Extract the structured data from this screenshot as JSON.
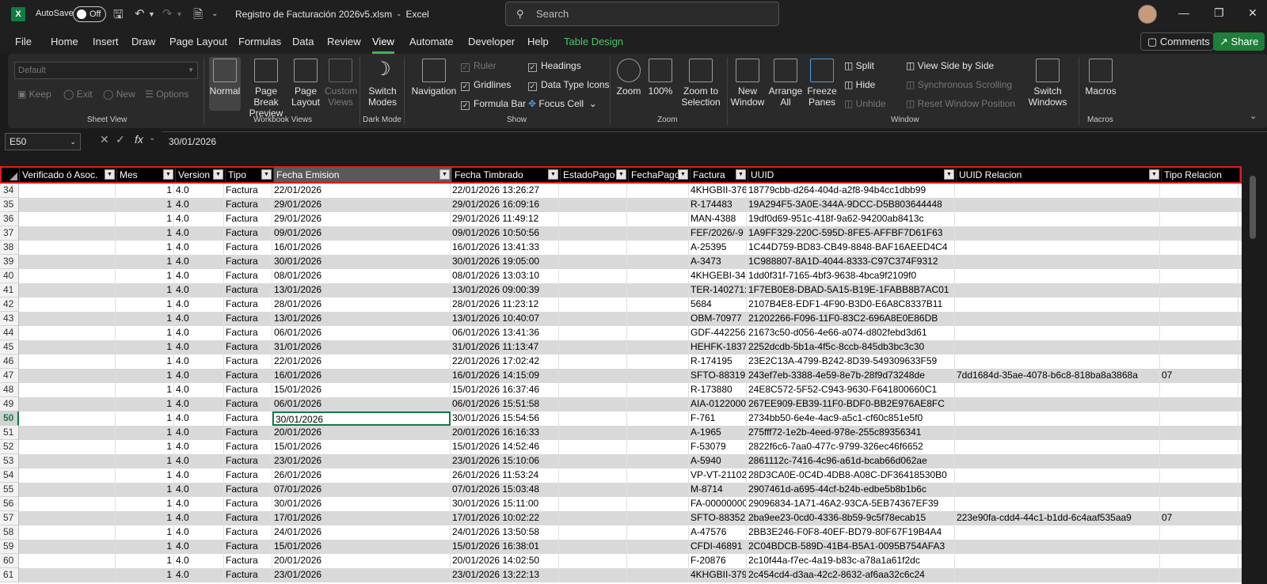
{
  "titlebar": {
    "autosave_label": "AutoSave",
    "autosave_state": "Off",
    "filename": "Registro de Facturación 2026v5.xlsm",
    "app": "Excel",
    "search_placeholder": "Search"
  },
  "menu": {
    "items": [
      "File",
      "Home",
      "Insert",
      "Draw",
      "Page Layout",
      "Formulas",
      "Data",
      "Review",
      "View",
      "Automate",
      "Developer",
      "Help",
      "Table Design"
    ],
    "active": "View",
    "comments": "Comments",
    "share": "Share"
  },
  "ribbon": {
    "sheet_view": {
      "dropdown": "Default",
      "keep": "Keep",
      "exit": "Exit",
      "new": "New",
      "options": "Options",
      "label": "Sheet View"
    },
    "workbook_views": {
      "normal": "Normal",
      "page_break": "Page Break Preview",
      "page_layout": "Page Layout",
      "custom_views": "Custom Views",
      "label": "Workbook Views"
    },
    "dark_mode": {
      "switch": "Switch Modes",
      "label": "Dark Mode"
    },
    "show": {
      "navigation": "Navigation",
      "ruler": "Ruler",
      "gridlines": "Gridlines",
      "formula_bar": "Formula Bar",
      "headings": "Headings",
      "data_type_icons": "Data Type Icons",
      "focus_cell": "Focus Cell",
      "label": "Show"
    },
    "zoom": {
      "zoom": "Zoom",
      "hundred": "100%",
      "zoom_to_selection": "Zoom to Selection",
      "label": "Zoom"
    },
    "window": {
      "new_window": "New Window",
      "arrange_all": "Arrange All",
      "freeze_panes": "Freeze Panes",
      "split": "Split",
      "hide": "Hide",
      "unhide": "Unhide",
      "side_by_side": "View Side by Side",
      "sync_scroll": "Synchronous Scrolling",
      "reset_pos": "Reset Window Position",
      "switch_windows": "Switch Windows",
      "label": "Window"
    },
    "macros": {
      "macros": "Macros",
      "label": "Macros"
    }
  },
  "formula_bar": {
    "cell_ref": "E50",
    "value": "30/01/2026"
  },
  "columns": [
    "Verificado ó Asoc.",
    "Mes",
    "Version",
    "Tipo",
    "Fecha Emision",
    "Fecha Timbrado",
    "EstadoPago",
    "FechaPago",
    "Factura",
    "UUID",
    "UUID Relacion",
    "Tipo Relacion"
  ],
  "rows": [
    {
      "n": "34",
      "mes": "1",
      "ver": "4.0",
      "tipo": "Factura",
      "fe": "22/01/2026",
      "ft": "22/01/2026 13:26:27",
      "fac": "4KHGBII-376",
      "uuid": "18779cbb-d264-404d-a2f8-94b4cc1dbb99",
      "rel": "",
      "tr": ""
    },
    {
      "n": "35",
      "mes": "1",
      "ver": "4.0",
      "tipo": "Factura",
      "fe": "29/01/2026",
      "ft": "29/01/2026 16:09:16",
      "fac": "R-174483",
      "uuid": "19A294F5-3A0E-344A-9DCC-D5B803644448",
      "rel": "",
      "tr": ""
    },
    {
      "n": "36",
      "mes": "1",
      "ver": "4.0",
      "tipo": "Factura",
      "fe": "29/01/2026",
      "ft": "29/01/2026 11:49:12",
      "fac": "MAN-4388",
      "uuid": "19df0d69-951c-418f-9a62-94200ab8413c",
      "rel": "",
      "tr": ""
    },
    {
      "n": "37",
      "mes": "1",
      "ver": "4.0",
      "tipo": "Factura",
      "fe": "09/01/2026",
      "ft": "09/01/2026 10:50:56",
      "fac": "FEF/2026/-9",
      "uuid": "1A9FF329-220C-595D-8FE5-AFFBF7D61F63",
      "rel": "",
      "tr": ""
    },
    {
      "n": "38",
      "mes": "1",
      "ver": "4.0",
      "tipo": "Factura",
      "fe": "16/01/2026",
      "ft": "16/01/2026 13:41:33",
      "fac": "A-25395",
      "uuid": "1C44D759-BD83-CB49-8848-BAF16AEED4C4",
      "rel": "",
      "tr": ""
    },
    {
      "n": "39",
      "mes": "1",
      "ver": "4.0",
      "tipo": "Factura",
      "fe": "30/01/2026",
      "ft": "30/01/2026 19:05:00",
      "fac": "A-3473",
      "uuid": "1C988807-8A1D-4044-8333-C97C374F9312",
      "rel": "",
      "tr": ""
    },
    {
      "n": "40",
      "mes": "1",
      "ver": "4.0",
      "tipo": "Factura",
      "fe": "08/01/2026",
      "ft": "08/01/2026 13:03:10",
      "fac": "4KHGEBI-34(",
      "uuid": "1dd0f31f-7165-4bf3-9638-4bca9f2109f0",
      "rel": "",
      "tr": ""
    },
    {
      "n": "41",
      "mes": "1",
      "ver": "4.0",
      "tipo": "Factura",
      "fe": "13/01/2026",
      "ft": "13/01/2026 09:00:39",
      "fac": "TER-140271:",
      "uuid": "1F7EB0E8-DBAD-5A15-B19E-1FABB8B7AC01",
      "rel": "",
      "tr": ""
    },
    {
      "n": "42",
      "mes": "1",
      "ver": "4.0",
      "tipo": "Factura",
      "fe": "28/01/2026",
      "ft": "28/01/2026 11:23:12",
      "fac": "5684",
      "uuid": "2107B4E8-EDF1-4F90-B3D0-E6A8C8337B11",
      "rel": "",
      "tr": ""
    },
    {
      "n": "43",
      "mes": "1",
      "ver": "4.0",
      "tipo": "Factura",
      "fe": "13/01/2026",
      "ft": "13/01/2026 10:40:07",
      "fac": "OBM-70977",
      "uuid": "21202266-F096-11F0-83C2-696A8E0E86DB",
      "rel": "",
      "tr": ""
    },
    {
      "n": "44",
      "mes": "1",
      "ver": "4.0",
      "tipo": "Factura",
      "fe": "06/01/2026",
      "ft": "06/01/2026 13:41:36",
      "fac": "GDF-442256",
      "uuid": "21673c50-d056-4e66-a074-d802febd3d61",
      "rel": "",
      "tr": ""
    },
    {
      "n": "45",
      "mes": "1",
      "ver": "4.0",
      "tipo": "Factura",
      "fe": "31/01/2026",
      "ft": "31/01/2026 11:13:47",
      "fac": "HEHFK-1837",
      "uuid": "2252dcdb-5b1a-4f5c-8ccb-845db3bc3c30",
      "rel": "",
      "tr": ""
    },
    {
      "n": "46",
      "mes": "1",
      "ver": "4.0",
      "tipo": "Factura",
      "fe": "22/01/2026",
      "ft": "22/01/2026 17:02:42",
      "fac": "R-174195",
      "uuid": "23E2C13A-4799-B242-8D39-549309633F59",
      "rel": "",
      "tr": ""
    },
    {
      "n": "47",
      "mes": "1",
      "ver": "4.0",
      "tipo": "Factura",
      "fe": "16/01/2026",
      "ft": "16/01/2026 14:15:09",
      "fac": "SFTO-88319",
      "uuid": "243ef7eb-3388-4e59-8e7b-28f9d73248de",
      "rel": "7dd1684d-35ae-4078-b6c8-818ba8a3868a",
      "tr": "07"
    },
    {
      "n": "48",
      "mes": "1",
      "ver": "4.0",
      "tipo": "Factura",
      "fe": "15/01/2026",
      "ft": "15/01/2026 16:37:46",
      "fac": "R-173880",
      "uuid": "24E8C572-5F52-C943-9630-F641800660C1",
      "rel": "",
      "tr": ""
    },
    {
      "n": "49",
      "mes": "1",
      "ver": "4.0",
      "tipo": "Factura",
      "fe": "06/01/2026",
      "ft": "06/01/2026 15:51:58",
      "fac": "AIA-0122000",
      "uuid": "267EE909-EB39-11F0-BDF0-BB2E976AE8FC",
      "rel": "",
      "tr": ""
    },
    {
      "n": "50",
      "mes": "1",
      "ver": "4.0",
      "tipo": "Factura",
      "fe": "30/01/2026",
      "ft": "30/01/2026 15:54:56",
      "fac": "F-761",
      "uuid": "2734bb50-6e4e-4ac9-a5c1-cf60c851e5f0",
      "rel": "",
      "tr": ""
    },
    {
      "n": "51",
      "mes": "1",
      "ver": "4.0",
      "tipo": "Factura",
      "fe": "20/01/2026",
      "ft": "20/01/2026 16:16:33",
      "fac": "A-1965",
      "uuid": "275fff72-1e2b-4eed-978e-255c89356341",
      "rel": "",
      "tr": ""
    },
    {
      "n": "52",
      "mes": "1",
      "ver": "4.0",
      "tipo": "Factura",
      "fe": "15/01/2026",
      "ft": "15/01/2026 14:52:46",
      "fac": "F-53079",
      "uuid": "2822f6c6-7aa0-477c-9799-326ec46f6652",
      "rel": "",
      "tr": ""
    },
    {
      "n": "53",
      "mes": "1",
      "ver": "4.0",
      "tipo": "Factura",
      "fe": "23/01/2026",
      "ft": "23/01/2026 15:10:06",
      "fac": "A-5940",
      "uuid": "2861112c-7416-4c96-a61d-bcab66d062ae",
      "rel": "",
      "tr": ""
    },
    {
      "n": "54",
      "mes": "1",
      "ver": "4.0",
      "tipo": "Factura",
      "fe": "26/01/2026",
      "ft": "26/01/2026 11:53:24",
      "fac": "VP-VT-21102",
      "uuid": "28D3CA0E-0C4D-4DB8-A08C-DF36418530B0",
      "rel": "",
      "tr": ""
    },
    {
      "n": "55",
      "mes": "1",
      "ver": "4.0",
      "tipo": "Factura",
      "fe": "07/01/2026",
      "ft": "07/01/2026 15:03:48",
      "fac": "M-8714",
      "uuid": "2907461d-a695-44cf-b24b-edbe5b8b1b6c",
      "rel": "",
      "tr": ""
    },
    {
      "n": "56",
      "mes": "1",
      "ver": "4.0",
      "tipo": "Factura",
      "fe": "30/01/2026",
      "ft": "30/01/2026 15:11:00",
      "fac": "FA-00000000",
      "uuid": "29096834-1A71-46A2-93CA-5EB74367EF39",
      "rel": "",
      "tr": ""
    },
    {
      "n": "57",
      "mes": "1",
      "ver": "4.0",
      "tipo": "Factura",
      "fe": "17/01/2026",
      "ft": "17/01/2026 10:02:22",
      "fac": "SFTO-88352",
      "uuid": "2ba9ee23-0cd0-4336-8b59-9c5f78ecab15",
      "rel": "223e90fa-cdd4-44c1-b1dd-6c4aaf535aa9",
      "tr": "07"
    },
    {
      "n": "58",
      "mes": "1",
      "ver": "4.0",
      "tipo": "Factura",
      "fe": "24/01/2026",
      "ft": "24/01/2026 13:50:58",
      "fac": "A-47576",
      "uuid": "2BB3E246-F0F8-40EF-BD79-80F67F19B4A4",
      "rel": "",
      "tr": ""
    },
    {
      "n": "59",
      "mes": "1",
      "ver": "4.0",
      "tipo": "Factura",
      "fe": "15/01/2026",
      "ft": "15/01/2026 16:38:01",
      "fac": "CFDI-46891",
      "uuid": "2C04BDCB-589D-41B4-B5A1-0095B754AFA3",
      "rel": "",
      "tr": ""
    },
    {
      "n": "60",
      "mes": "1",
      "ver": "4.0",
      "tipo": "Factura",
      "fe": "20/01/2026",
      "ft": "20/01/2026 14:02:50",
      "fac": "F-20876",
      "uuid": "2c10f44a-f7ec-4a19-b83c-a78a1a61f2dc",
      "rel": "",
      "tr": ""
    },
    {
      "n": "61",
      "mes": "1",
      "ver": "4.0",
      "tipo": "Factura",
      "fe": "23/01/2026",
      "ft": "23/01/2026 13:22:13",
      "fac": "4KHGBII-379",
      "uuid": "2c454cd4-d3aa-42c2-8632-af6aa32c6c24",
      "rel": "",
      "tr": ""
    }
  ],
  "active_row": "50"
}
